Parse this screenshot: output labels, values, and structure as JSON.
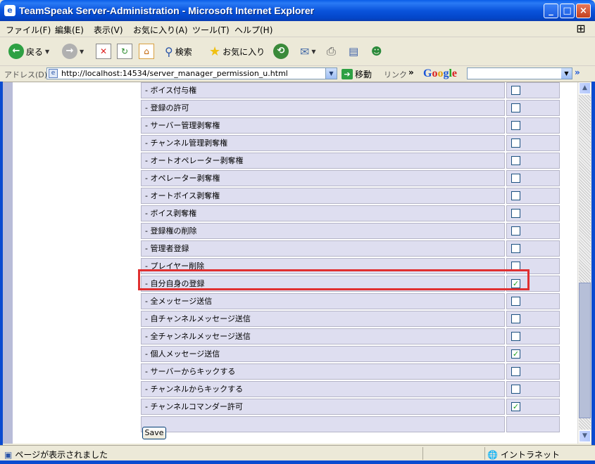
{
  "window": {
    "title": "TeamSpeak Server-Administration - Microsoft Internet Explorer"
  },
  "menu": [
    "ファイル(F)",
    "編集(E)",
    "表示(V)",
    "お気に入り(A)",
    "ツール(T)",
    "ヘルプ(H)"
  ],
  "toolbar": {
    "back": "戻る",
    "search": "検索",
    "favorites": "お気に入り"
  },
  "address": {
    "label": "アドレス(D)",
    "url": "http://localhost:14534/server_manager_permission_u.html",
    "go": "移動",
    "links": "リンク",
    "google": "Google"
  },
  "permissions": [
    {
      "label": "- ボイス付与権",
      "checked": false
    },
    {
      "label": "- 登録の許可",
      "checked": false
    },
    {
      "label": "- サーバー管理剥奪権",
      "checked": false
    },
    {
      "label": "- チャンネル管理剥奪権",
      "checked": false
    },
    {
      "label": "- オートオペレーター剥奪権",
      "checked": false
    },
    {
      "label": "- オペレーター剥奪権",
      "checked": false
    },
    {
      "label": "- オートボイス剥奪権",
      "checked": false
    },
    {
      "label": "- ボイス剥奪権",
      "checked": false
    },
    {
      "label": "- 登録権の削除",
      "checked": false
    },
    {
      "label": "- 管理者登録",
      "checked": false
    },
    {
      "label": "- プレイヤー削除",
      "checked": false
    },
    {
      "label": "- 自分自身の登録",
      "checked": true
    },
    {
      "label": "- 全メッセージ送信",
      "checked": false
    },
    {
      "label": "- 自チャンネルメッセージ送信",
      "checked": false
    },
    {
      "label": "- 全チャンネルメッセージ送信",
      "checked": false
    },
    {
      "label": "- 個人メッセージ送信",
      "checked": true
    },
    {
      "label": "- サーバーからキックする",
      "checked": false
    },
    {
      "label": "- チャンネルからキックする",
      "checked": false
    },
    {
      "label": "- チャンネルコマンダー許可",
      "checked": true
    }
  ],
  "save_label": "Save",
  "status": {
    "text": "ページが表示されました",
    "zone": "イントラネット"
  },
  "colors": {
    "highlight": "#e03030",
    "row_bg": "#dedef0",
    "title_blue": "#0a54dc"
  }
}
